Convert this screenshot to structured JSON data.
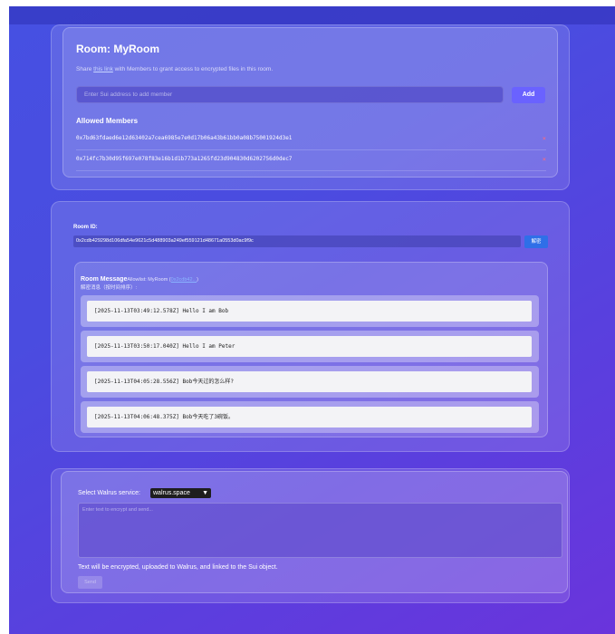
{
  "room": {
    "title": "Room: MyRoom",
    "share_pre": "Share ",
    "share_link": "this link",
    "share_post": " with Members to grant access to encrypted files in this room.",
    "member_input_placeholder": "Enter Sui address to add member",
    "add_label": "Add",
    "members_title": "Allowed Members",
    "members": [
      "0x7bd63fdaed6e12d63402a7cea6985e7e0d17b06a43b61bb0a08b75001924d3e1",
      "0x714fc7b30d95f697e078f83e16b1d1b773a1265fd23d904830d6202756d0dec7"
    ],
    "remove_glyph": "×"
  },
  "room_view": {
    "id_label": "Room ID:",
    "id_value": "0x2cdb429298d106dfa54e9621c5d488903a249ef559121d48671a0553d0ac9f9c",
    "decrypt_label": "解密",
    "msg_title": "Room Message",
    "allowlist_pre": "Allowlist: MyRoom (",
    "allowlist_link": "0x2cdb42...",
    "allowlist_post": ")",
    "decrypted_label": "解密消息（按时间排序）:",
    "messages": [
      "[2025-11-13T03:49:12.578Z] Hello I am Bob",
      "[2025-11-13T03:50:17.040Z] Hello I am Peter",
      "[2025-11-13T04:05:28.556Z] Bob今天过的怎么样?",
      "[2025-11-13T04:06:48.375Z] Bob今天吃了3碗饭。"
    ]
  },
  "composer": {
    "walrus_label": "Select Walrus service:",
    "walrus_value": "walrus.space",
    "textarea_placeholder": "Enter text to encrypt and send...",
    "note": "Text will be encrypted, uploaded to Walrus, and linked to the Sui object.",
    "send_label": "Send"
  }
}
